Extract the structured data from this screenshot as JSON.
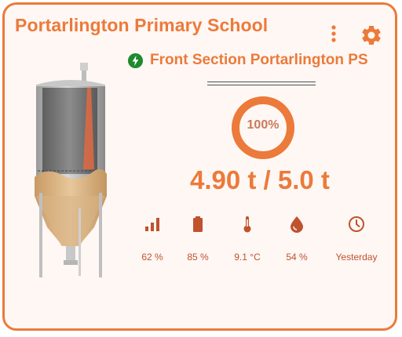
{
  "card": {
    "title": "Portarlington Primary School",
    "subtitle": "Front Section Portarlington PS",
    "fill_percent_label": "100%",
    "fill_fraction": 1.0,
    "weight": "4.90 t / 5.0 t"
  },
  "stats": [
    {
      "icon": "signal-icon",
      "value": "62 %"
    },
    {
      "icon": "battery-icon",
      "value": "85 %"
    },
    {
      "icon": "thermometer-icon",
      "value": "9.1 °C"
    },
    {
      "icon": "humidity-icon",
      "value": "54 %"
    },
    {
      "icon": "clock-icon",
      "value": "Yesterday"
    }
  ],
  "colors": {
    "accent": "#ec7a3a",
    "value_text": "#c0522d",
    "status_online": "#1f8a2e",
    "card_background": "#fef7f4"
  }
}
